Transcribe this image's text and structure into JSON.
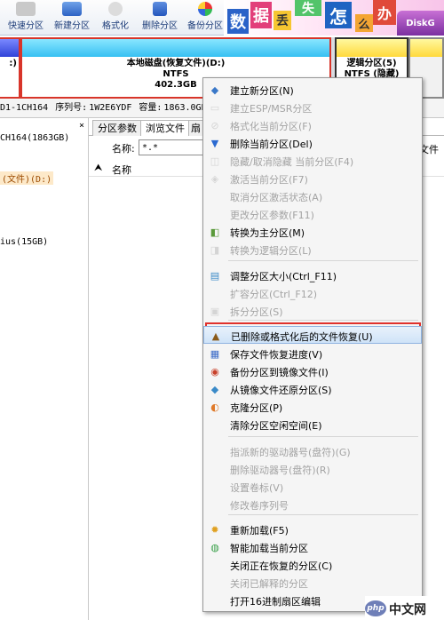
{
  "toolbar": {
    "buttons": [
      {
        "label": "快速分区",
        "color": "#3b8b3b"
      },
      {
        "label": "新建分区",
        "color": "#3b6fd0"
      },
      {
        "label": "格式化",
        "color": "#7c7c7c"
      },
      {
        "label": "删除分区",
        "color": "#2b61c6"
      },
      {
        "label": "备份分区",
        "color": "#d23b2b"
      }
    ]
  },
  "banner": {
    "chars": [
      "数",
      "据",
      "丢",
      "失",
      "怎",
      "么",
      "办"
    ],
    "brand": "DiskG"
  },
  "diskbar": {
    "left_label": ":)",
    "main": {
      "title": "本地磁盘(恢复文件)(D:)",
      "fs": "NTFS",
      "size": "402.3GB"
    },
    "right": {
      "title": "逻辑分区(5)",
      "fs": "NTFS (隐藏)"
    }
  },
  "info": {
    "model": "D1-1CH164",
    "serial_label": "序列号:",
    "serial": "1W2E6YDF",
    "capacity_label": "容量:",
    "capacity": "1863.0GB("
  },
  "tree": {
    "close": "×",
    "items": [
      {
        "text": "CH164(1863GB)"
      },
      {
        "text": "(文件)(D:)"
      },
      {
        "text": "ius(15GB)"
      }
    ]
  },
  "panel": {
    "tabs": [
      "分区参数",
      "浏览文件",
      "扇"
    ],
    "name_label": "名称:",
    "name_value": "*.*",
    "col_name": "名称",
    "col_file": "文件"
  },
  "menu": {
    "items": [
      {
        "label": "建立新分区(N)",
        "enabled": true,
        "icon": "new-partition-icon",
        "glyph": "◆",
        "color": "#3a78c8"
      },
      {
        "label": "建立ESP/MSR分区",
        "enabled": false,
        "icon": "esp-partition-icon",
        "glyph": "▭",
        "color": "#999999"
      },
      {
        "label": "格式化当前分区(F)",
        "enabled": false,
        "icon": "format-icon",
        "glyph": "⊘",
        "color": "#999999"
      },
      {
        "label": "删除当前分区(Del)",
        "enabled": true,
        "icon": "delete-icon",
        "glyph": "▼",
        "color": "#2b6ad1"
      },
      {
        "label": "隐藏/取消隐藏 当前分区(F4)",
        "enabled": false,
        "icon": "hide-icon",
        "glyph": "◫",
        "color": "#999999"
      },
      {
        "label": "激活当前分区(F7)",
        "enabled": false,
        "icon": "activate-icon",
        "glyph": "◈",
        "color": "#999999"
      },
      {
        "label": "取消分区激活状态(A)",
        "enabled": false,
        "icon": "",
        "glyph": "",
        "color": "#999999"
      },
      {
        "label": "更改分区参数(F11)",
        "enabled": false,
        "icon": "",
        "glyph": "",
        "color": "#999999"
      },
      {
        "label": "转换为主分区(M)",
        "enabled": true,
        "icon": "convert-primary-icon",
        "glyph": "◧",
        "color": "#5a9a3a"
      },
      {
        "label": "转换为逻辑分区(L)",
        "enabled": false,
        "icon": "convert-logical-icon",
        "glyph": "◨",
        "color": "#999999"
      },
      {
        "label": "调整分区大小(Ctrl_F11)",
        "enabled": true,
        "icon": "resize-icon",
        "glyph": "▤",
        "color": "#3a8ac8"
      },
      {
        "label": "扩容分区(Ctrl_F12)",
        "enabled": false,
        "icon": "",
        "glyph": "",
        "color": "#999999"
      },
      {
        "label": "拆分分区(S)",
        "enabled": false,
        "icon": "split-icon",
        "glyph": "▣",
        "color": "#999999"
      },
      {
        "label": "已删除或格式化后的文件恢复(U)",
        "enabled": true,
        "icon": "file-recovery-icon",
        "glyph": "▲",
        "color": "#8a5a1a"
      },
      {
        "label": "保存文件恢复进度(V)",
        "enabled": true,
        "icon": "save-progress-icon",
        "glyph": "▦",
        "color": "#3a6ac8"
      },
      {
        "label": "备份分区到镜像文件(I)",
        "enabled": true,
        "icon": "backup-image-icon",
        "glyph": "◉",
        "color": "#c8402a"
      },
      {
        "label": "从镜像文件还原分区(S)",
        "enabled": true,
        "icon": "restore-image-icon",
        "glyph": "◆",
        "color": "#3a8ac8"
      },
      {
        "label": "克隆分区(P)",
        "enabled": true,
        "icon": "clone-icon",
        "glyph": "◐",
        "color": "#e07a2a"
      },
      {
        "label": "清除分区空闲空间(E)",
        "enabled": true,
        "icon": "",
        "glyph": "",
        "color": "#999999"
      },
      {
        "label": "指派新的驱动器号(盘符)(G)",
        "enabled": false,
        "icon": "",
        "glyph": "",
        "color": "#999999"
      },
      {
        "label": "删除驱动器号(盘符)(R)",
        "enabled": false,
        "icon": "",
        "glyph": "",
        "color": "#999999"
      },
      {
        "label": "设置卷标(V)",
        "enabled": false,
        "icon": "",
        "glyph": "",
        "color": "#999999"
      },
      {
        "label": "修改卷序列号",
        "enabled": false,
        "icon": "",
        "glyph": "",
        "color": "#999999"
      },
      {
        "label": "重新加载(F5)",
        "enabled": true,
        "icon": "reload-icon",
        "glyph": "✹",
        "color": "#e0a020"
      },
      {
        "label": "智能加载当前分区",
        "enabled": true,
        "icon": "smart-load-icon",
        "glyph": "◍",
        "color": "#3aa04a"
      },
      {
        "label": "关闭正在恢复的分区(C)",
        "enabled": true,
        "icon": "",
        "glyph": "",
        "color": "#999999"
      },
      {
        "label": "关闭已解释的分区",
        "enabled": false,
        "icon": "",
        "glyph": "",
        "color": "#999999"
      },
      {
        "label": "打开16进制扇区编辑",
        "enabled": true,
        "icon": "",
        "glyph": "",
        "color": "#999999"
      }
    ]
  },
  "watermark": {
    "php": "php",
    "text": "中文网"
  }
}
